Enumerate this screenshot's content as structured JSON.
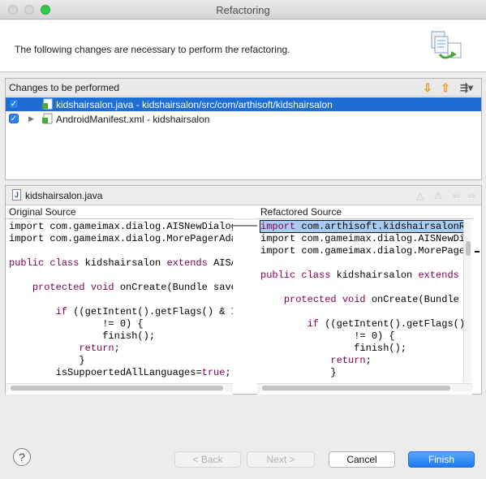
{
  "window": {
    "title": "Refactoring"
  },
  "header": {
    "message": "The following changes are necessary to perform the refactoring."
  },
  "changes": {
    "label": "Changes to be performed",
    "items": [
      {
        "label": "kidshairsalon.java - kidshairsalon/src/com/arthisoft/kidshairsalon",
        "checked": true,
        "selected": true
      },
      {
        "label": "AndroidManifest.xml - kidshairsalon",
        "checked": true,
        "selected": false
      }
    ]
  },
  "compare": {
    "file_name": "kidshairsalon.java",
    "original_title": "Original Source",
    "refactored_title": "Refactored Source",
    "original_lines": [
      "import com.gameimax.dialog.AISNewDialog",
      "import com.gameimax.dialog.MorePagerAda",
      "",
      "public class kidshairsalon extends AISA",
      "",
      "    protected void onCreate(Bundle save",
      "",
      "        if ((getIntent().getFlags() & I",
      "                != 0) {",
      "                finish();",
      "            return;",
      "            }",
      "        isSuppoertedAllLanguages=true;"
    ],
    "refactored_lines": [
      "import com.arthisoft.kidshairsalonR",
      "import com.gameimax.dialog.AISNewDi",
      "import com.gameimax.dialog.MorePage",
      "",
      "public class kidshairsalon extends ",
      "",
      "    protected void onCreate(Bundle",
      "",
      "        if ((getIntent().getFlags()",
      "                != 0) {",
      "                finish();",
      "            return;",
      "            }"
    ]
  },
  "buttons": {
    "help": "?",
    "back": "< Back",
    "next": "Next >",
    "cancel": "Cancel",
    "finish": "Finish"
  }
}
